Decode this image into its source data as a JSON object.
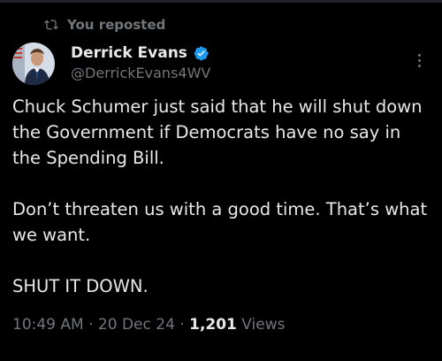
{
  "repost": {
    "label": "You reposted"
  },
  "author": {
    "display_name": "Derrick Evans",
    "handle": "@DerrickEvans4WV",
    "verified": true
  },
  "tweet": {
    "paragraphs": [
      "Chuck Schumer just said that he will shut down the Government if Democrats have no say in the Spending Bill.",
      "Don’t threaten us with a good time. That’s what we want.",
      "SHUT IT DOWN."
    ]
  },
  "meta": {
    "time": "10:49 AM",
    "separator": " · ",
    "date": "20 Dec 24",
    "views_count": "1,201",
    "views_label": "Views"
  },
  "colors": {
    "background": "#000000",
    "text_primary": "#e7e9ea",
    "text_secondary": "#71767b",
    "verified_blue": "#1d9bf0"
  },
  "icons": {
    "repost": "repost-icon",
    "verified": "verified-badge-icon",
    "more": "more-options-icon"
  }
}
